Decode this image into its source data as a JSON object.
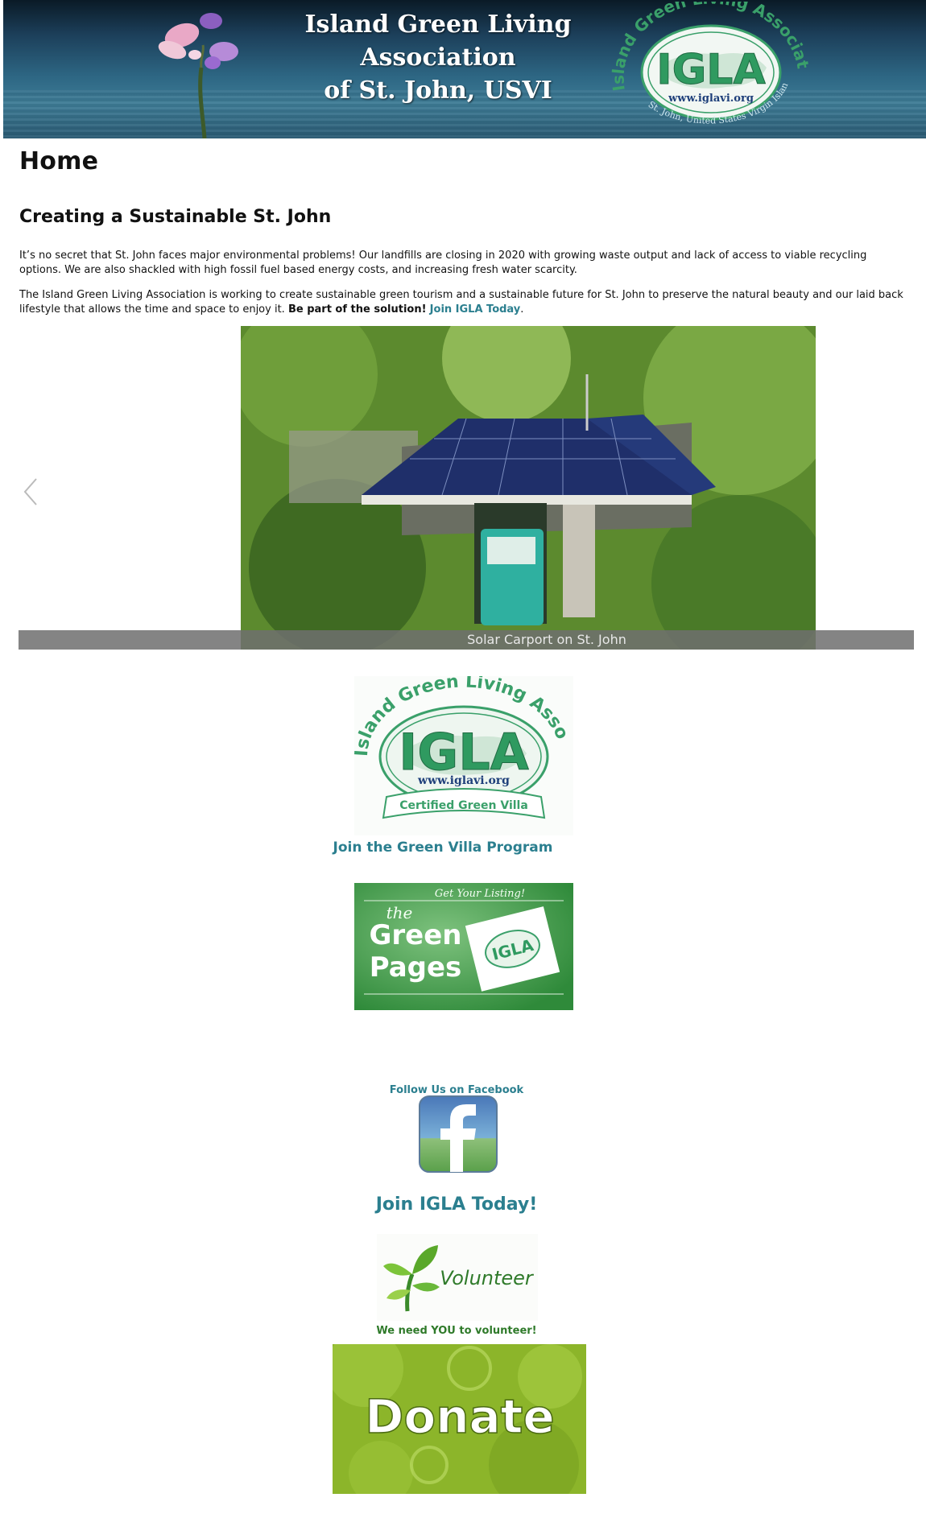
{
  "header": {
    "title_line1": "Island Green Living Association",
    "title_line2": "of St. John, USVI",
    "logo": {
      "arc_text": "Island Green Living Association",
      "mark": "IGLA",
      "url": "www.iglavi.org",
      "bottom_arc": "St. John, United States Virgin Islands"
    }
  },
  "page": {
    "title": "Home",
    "subtitle": "Creating a Sustainable St. John",
    "para1": "It’s no secret that St. John faces major environmental problems! Our landfills are closing in 2020 with growing waste output and lack of access to viable recycling options. We are also shackled with high fossil fuel based energy costs, and increasing fresh water scarcity.",
    "para2_text": "The Island Green Living Association is working to create sustainable green tourism and a sustainable future for St. John to preserve the natural beauty and our laid back lifestyle that allows the time and space to enjoy it.",
    "para2_bold": "Be part of the solution!",
    "para2_link": "Join IGLA Today",
    "para2_end": "."
  },
  "slider": {
    "caption": "Solar Carport on St. John"
  },
  "green_villa": {
    "badge_arc": "Island Green Living Association",
    "badge_mark": "IGLA",
    "badge_url": "www.iglavi.org",
    "ribbon": "Certified Green Villa",
    "link": "Join the Green Villa Program"
  },
  "green_pages": {
    "top": "Get Your Listing!",
    "the": "the",
    "line1": "Green",
    "line2": "Pages"
  },
  "facebook": {
    "label": "Follow Us on Facebook",
    "icon": "facebook-icon"
  },
  "join": {
    "label": "Join IGLA Today!"
  },
  "volunteer": {
    "word": "Volunteer",
    "caption": "We need YOU to volunteer!"
  },
  "donate": {
    "label": "Donate"
  },
  "colors": {
    "teal": "#2b7f8f",
    "green": "#3a9a5a",
    "donate_green": "#8cb52a"
  }
}
